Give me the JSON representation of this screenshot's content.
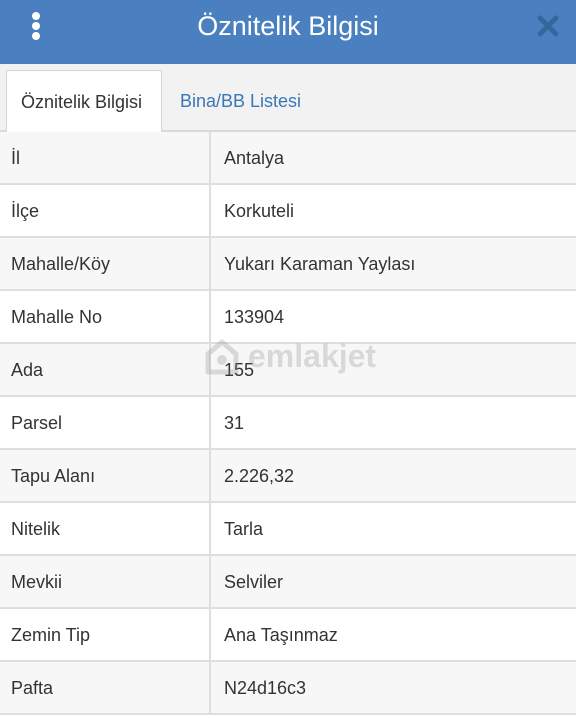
{
  "header": {
    "title": "Öznitelik Bilgisi",
    "menu_icon": "more-vertical-icon",
    "close_icon": "close-icon"
  },
  "tabs": [
    {
      "label": "Öznitelik Bilgisi",
      "active": true
    },
    {
      "label": "Bina/BB Listesi",
      "active": false
    }
  ],
  "rows": [
    {
      "label": "İl",
      "value": "Antalya"
    },
    {
      "label": "İlçe",
      "value": "Korkuteli"
    },
    {
      "label": "Mahalle/Köy",
      "value": "Yukarı Karaman Yaylası"
    },
    {
      "label": "Mahalle No",
      "value": "133904"
    },
    {
      "label": "Ada",
      "value": "155"
    },
    {
      "label": "Parsel",
      "value": "31"
    },
    {
      "label": "Tapu Alanı",
      "value": "2.226,32"
    },
    {
      "label": "Nitelik",
      "value": "Tarla"
    },
    {
      "label": "Mevkii",
      "value": "Selviler"
    },
    {
      "label": "Zemin Tip",
      "value": "Ana Taşınmaz"
    },
    {
      "label": "Pafta",
      "value": "N24d16c3"
    }
  ],
  "watermark": {
    "text": "emlakjet"
  },
  "colors": {
    "header_bg": "#4a80bf",
    "tab_link": "#3a77b8",
    "row_alt": "#f7f7f7",
    "border": "#dedede"
  }
}
